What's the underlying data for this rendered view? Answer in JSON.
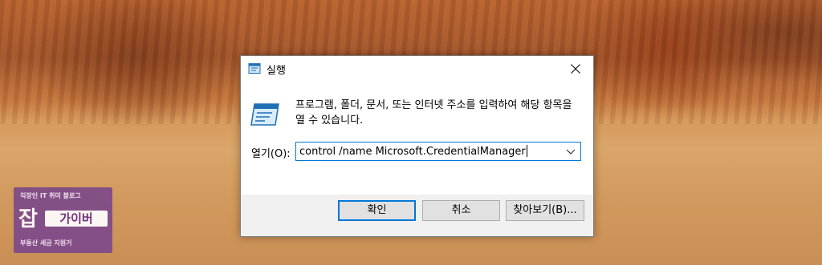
{
  "watermark": {
    "top": "직장인 IT 취미 블로그",
    "big": "잡",
    "mid": "가이버",
    "bottom": "부동산 세금 지원거"
  },
  "dialog": {
    "title": "실행",
    "description": "프로그램, 폴더, 문서, 또는 인터넷 주소를 입력하여 해당 항목을 열 수 있습니다.",
    "open_label": "열기(O):",
    "open_value": "control /name Microsoft.CredentialManager",
    "ok_label": "확인",
    "cancel_label": "취소",
    "browse_label": "찾아보기(B)...",
    "icons": [
      "run-icon",
      "close-icon",
      "chevron-down-icon"
    ],
    "accent_color": "#0078d7"
  }
}
